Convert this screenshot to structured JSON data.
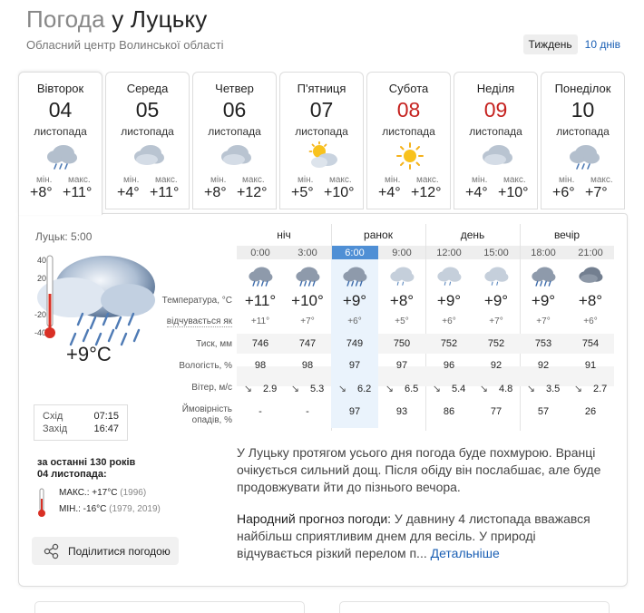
{
  "header": {
    "title_prefix": "Погода",
    "title_city": "у Луцьку",
    "subtitle": "Обласний центр Волинської області",
    "view_week": "Тиждень",
    "view_10days": "10 днів"
  },
  "days": [
    {
      "dow": "Вівторок",
      "num": "04",
      "month": "листопада",
      "min_label": "мін.",
      "max_label": "макс.",
      "min": "+8°",
      "max": "+11°",
      "icon": "cloud-rain-icon",
      "weekend": false
    },
    {
      "dow": "Середа",
      "num": "05",
      "month": "листопада",
      "min_label": "мін.",
      "max_label": "макс.",
      "min": "+4°",
      "max": "+11°",
      "icon": "cloud-icon",
      "weekend": false
    },
    {
      "dow": "Четвер",
      "num": "06",
      "month": "листопада",
      "min_label": "мін.",
      "max_label": "макс.",
      "min": "+8°",
      "max": "+12°",
      "icon": "cloud-icon",
      "weekend": false
    },
    {
      "dow": "П'ятниця",
      "num": "07",
      "month": "листопада",
      "min_label": "мін.",
      "max_label": "макс.",
      "min": "+5°",
      "max": "+10°",
      "icon": "sun-cloud-icon",
      "weekend": false
    },
    {
      "dow": "Субота",
      "num": "08",
      "month": "листопада",
      "min_label": "мін.",
      "max_label": "макс.",
      "min": "+4°",
      "max": "+12°",
      "icon": "sun-icon",
      "weekend": true
    },
    {
      "dow": "Неділя",
      "num": "09",
      "month": "листопада",
      "min_label": "мін.",
      "max_label": "макс.",
      "min": "+4°",
      "max": "+10°",
      "icon": "cloud-icon",
      "weekend": true
    },
    {
      "dow": "Понеділок",
      "num": "10",
      "month": "листопада",
      "min_label": "мін.",
      "max_label": "макс.",
      "min": "+6°",
      "max": "+7°",
      "icon": "cloud-rain-icon",
      "weekend": false
    }
  ],
  "current": {
    "time": "Луцьк: 5:00",
    "scale": [
      "40",
      "20",
      "0",
      "-20",
      "-40"
    ],
    "temp": "+9°C",
    "sunrise_label": "Схід",
    "sunrise": "07:15",
    "sunset_label": "Захід",
    "sunset": "16:47"
  },
  "history": {
    "title": "за останні 130 років",
    "date": "04 листопада:",
    "max_label": "МАКС.:",
    "max": "+17°C",
    "max_year": "(1996)",
    "min_label": "МІН.:",
    "min": "-16°C",
    "min_years": "(1979, 2019)"
  },
  "share_label": "Поділитися погодою",
  "periods": [
    "ніч",
    "ранок",
    "день",
    "вечір"
  ],
  "hours": [
    "0:00",
    "3:00",
    "6:00",
    "9:00",
    "12:00",
    "15:00",
    "18:00",
    "21:00"
  ],
  "row_labels": {
    "temp": "Температура, °С",
    "feels": "відчувається як",
    "pressure": "Тиск, мм",
    "humidity": "Вологість, %",
    "wind": "Вітер, м/с",
    "precip_1": "Ймовірність",
    "precip_2": "опадів, %"
  },
  "hourly": {
    "icons": [
      "cloud-heavy-rain-icon",
      "cloud-heavy-rain-icon",
      "cloud-heavy-rain-icon",
      "cloud-light-rain-icon",
      "cloud-light-rain-icon",
      "cloud-light-rain-icon",
      "cloud-heavy-rain-icon",
      "cloud-dark-icon"
    ],
    "temp": [
      "+11°",
      "+10°",
      "+9°",
      "+8°",
      "+9°",
      "+9°",
      "+9°",
      "+8°"
    ],
    "feels": [
      "+11°",
      "+7°",
      "+6°",
      "+5°",
      "+6°",
      "+7°",
      "+7°",
      "+6°"
    ],
    "pressure": [
      "746",
      "747",
      "749",
      "750",
      "752",
      "752",
      "753",
      "754"
    ],
    "humidity": [
      "98",
      "98",
      "97",
      "97",
      "96",
      "92",
      "92",
      "91"
    ],
    "wind": [
      "2.9",
      "5.3",
      "6.2",
      "6.5",
      "5.4",
      "4.8",
      "3.5",
      "2.7"
    ],
    "precip": [
      "-",
      "-",
      "97",
      "93",
      "86",
      "77",
      "57",
      "26"
    ]
  },
  "description": "У Луцьку протягом усього дня погода буде похмурою. Вранці очікується сильний дощ. Після обіду він послабшає, але буде продовжувати йти до пізнього вечора.",
  "folk": {
    "title": "Народний прогноз погоди:",
    "text": " У давнину 4 листопада вважався найбільш сприятливим днем для весіль. У природі відчувається різкий перелом п...",
    "more": "Детальніше"
  }
}
